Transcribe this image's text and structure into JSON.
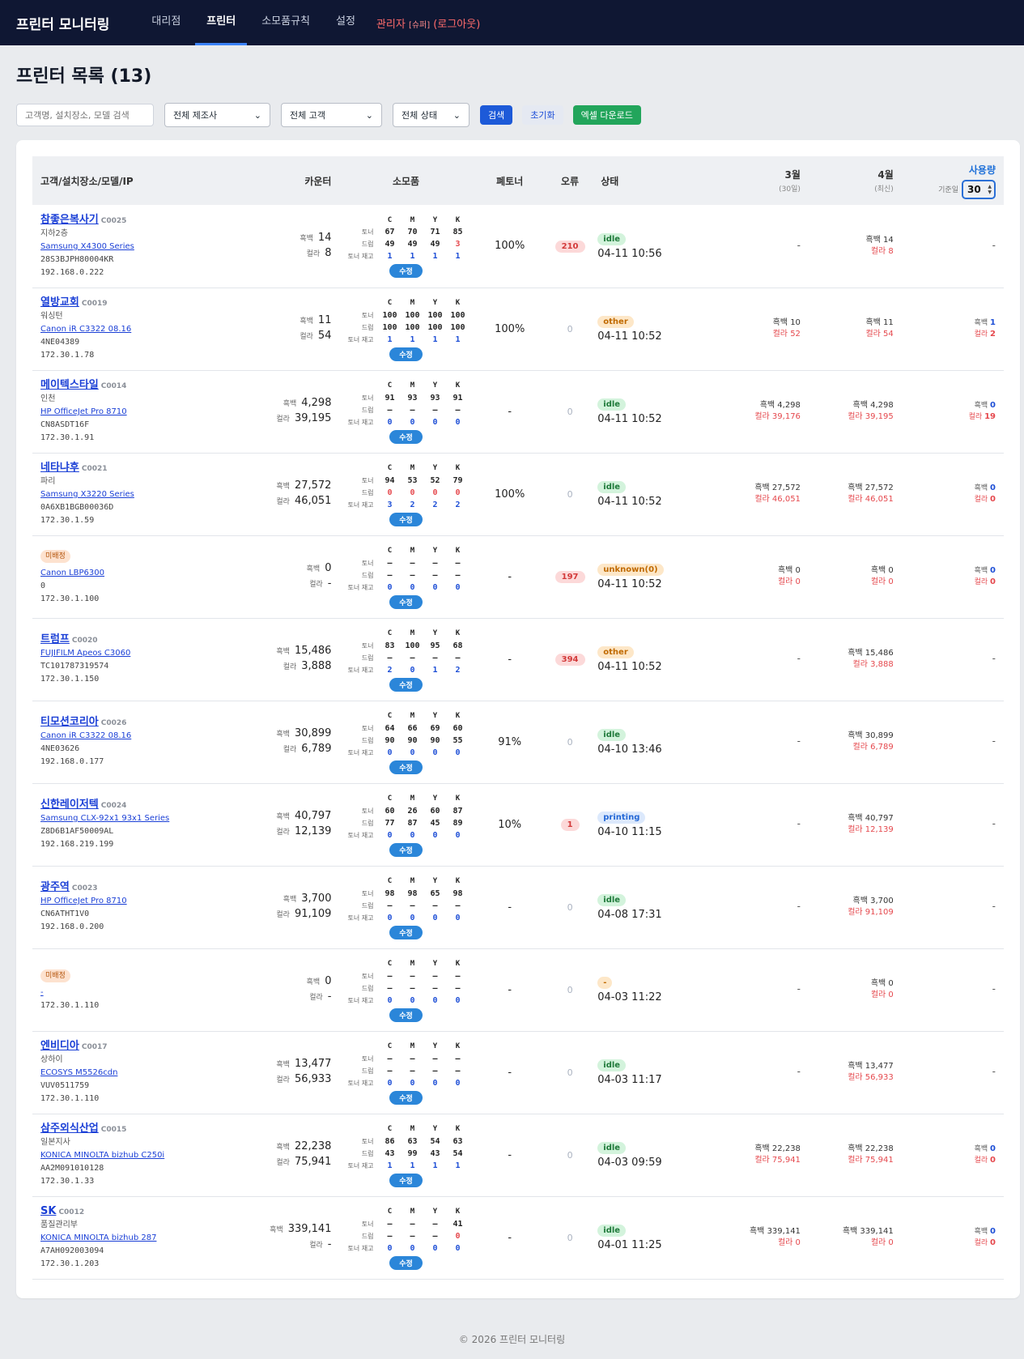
{
  "nav": {
    "brand": "프린터 모니터링",
    "items": [
      "대리점",
      "프린터",
      "소모품규칙",
      "설정"
    ],
    "active": 1,
    "admin_label": "관리자",
    "admin_role": "[슈퍼]",
    "logout": "(로그아웃)"
  },
  "page_title": "프린터 목록 (13)",
  "filters": {
    "search_placeholder": "고객명, 설치장소, 모델 검색",
    "maker": "전체 제조사",
    "customer": "전체 고객",
    "status": "전체 상태",
    "search_btn": "검색",
    "reset_btn": "초기화",
    "excel_btn": "엑셀 다운로드"
  },
  "table_headers": {
    "customer": "고객/설치장소/모델/IP",
    "counter": "카운터",
    "supplies": "소모품",
    "waste": "폐토너",
    "errors": "오류",
    "status": "상태",
    "m1": "3월",
    "m1_sub": "(30일)",
    "m2": "4월",
    "m2_sub": "(최신)",
    "usage": "사용량",
    "basis": "기준일",
    "basis_value": "30"
  },
  "labels": {
    "bw": "흑백",
    "color": "컬라",
    "toner": "토너",
    "drum": "드럼",
    "stock": "토너 재고",
    "edit": "수정",
    "unassigned": "미배정",
    "col_c": "C",
    "col_m": "M",
    "col_y": "Y",
    "col_k": "K"
  },
  "rows": [
    {
      "name": "참좋은복사기",
      "code": "C0025",
      "location": "지하2층",
      "model": "Samsung X4300 Series",
      "serial": "28S3BJPH80004KR",
      "ip": "192.168.0.222",
      "bw": "14",
      "color": "8",
      "toner": [
        "67",
        "70",
        "71",
        "85"
      ],
      "drum": [
        "49",
        "49",
        "49",
        "3"
      ],
      "drum_red": [
        false,
        false,
        false,
        true
      ],
      "stock": [
        "1",
        "1",
        "1",
        "1"
      ],
      "waste": "100%",
      "error": "210",
      "status": "idle",
      "status_class": "idle",
      "time": "04-11 10:56",
      "m1": null,
      "m2": {
        "bw": "14",
        "color": "8"
      },
      "usage": null
    },
    {
      "name": "열방교회",
      "code": "C0019",
      "location": "워싱턴",
      "model": "Canon iR C3322 08.16",
      "serial": "4NE04389",
      "ip": "172.30.1.78",
      "bw": "11",
      "color": "54",
      "toner": [
        "100",
        "100",
        "100",
        "100"
      ],
      "drum": [
        "100",
        "100",
        "100",
        "100"
      ],
      "stock": [
        "1",
        "1",
        "1",
        "1"
      ],
      "waste": "100%",
      "error": "0",
      "status": "other",
      "status_class": "other",
      "time": "04-11 10:52",
      "m1": {
        "bw": "10",
        "color": "52"
      },
      "m2": {
        "bw": "11",
        "color": "54"
      },
      "usage": {
        "bw": "1",
        "color": "2"
      }
    },
    {
      "name": "메이텍스타일",
      "code": "C0014",
      "location": "인천",
      "model": "HP OfficeJet Pro 8710",
      "serial": "CN8ASDT16F",
      "ip": "172.30.1.91",
      "bw": "4,298",
      "color": "39,195",
      "toner": [
        "91",
        "93",
        "93",
        "91"
      ],
      "drum": [
        "–",
        "–",
        "–",
        "–"
      ],
      "stock": [
        "0",
        "0",
        "0",
        "0"
      ],
      "waste": "-",
      "error": "0",
      "status": "idle",
      "status_class": "idle",
      "time": "04-11 10:52",
      "m1": {
        "bw": "4,298",
        "color": "39,176"
      },
      "m2": {
        "bw": "4,298",
        "color": "39,195"
      },
      "usage": {
        "bw": "0",
        "color": "19"
      }
    },
    {
      "name": "네타냐후",
      "code": "C0021",
      "location": "파리",
      "model": "Samsung X3220 Series",
      "serial": "0A6XB1BGB00036D",
      "ip": "172.30.1.59",
      "bw": "27,572",
      "color": "46,051",
      "toner": [
        "94",
        "53",
        "52",
        "79"
      ],
      "drum": [
        "0",
        "0",
        "0",
        "0"
      ],
      "drum_red": [
        true,
        true,
        true,
        true
      ],
      "stock": [
        "3",
        "2",
        "2",
        "2"
      ],
      "waste": "100%",
      "error": "0",
      "status": "idle",
      "status_class": "idle",
      "time": "04-11 10:52",
      "m1": {
        "bw": "27,572",
        "color": "46,051"
      },
      "m2": {
        "bw": "27,572",
        "color": "46,051"
      },
      "usage": {
        "bw": "0",
        "color": "0"
      }
    },
    {
      "unassigned": true,
      "model": "Canon LBP6300",
      "serial": "0",
      "ip": "172.30.1.100",
      "bw": "0",
      "color": "-",
      "toner": [
        "–",
        "–",
        "–",
        "–"
      ],
      "drum": [
        "–",
        "–",
        "–",
        "–"
      ],
      "stock": [
        "0",
        "0",
        "0",
        "0"
      ],
      "waste": "-",
      "error": "197",
      "status": "unknown(0)",
      "status_class": "other",
      "time": "04-11 10:52",
      "m1": {
        "bw": "0",
        "color": "0"
      },
      "m2": {
        "bw": "0",
        "color": "0"
      },
      "usage": {
        "bw": "0",
        "color": "0"
      }
    },
    {
      "name": "트럼프",
      "code": "C0020",
      "model": "FUJIFILM Apeos C3060",
      "serial": "TC101787319574",
      "ip": "172.30.1.150",
      "bw": "15,486",
      "color": "3,888",
      "toner": [
        "83",
        "100",
        "95",
        "68"
      ],
      "drum": [
        "–",
        "–",
        "–",
        "–"
      ],
      "stock": [
        "2",
        "0",
        "1",
        "2"
      ],
      "waste": "-",
      "error": "394",
      "status": "other",
      "status_class": "other",
      "time": "04-11 10:52",
      "m1": null,
      "m2": {
        "bw": "15,486",
        "color": "3,888"
      },
      "usage": null
    },
    {
      "name": "티모션코리아",
      "code": "C0026",
      "model": "Canon iR C3322 08.16",
      "serial": "4NE03626",
      "ip": "192.168.0.177",
      "bw": "30,899",
      "color": "6,789",
      "toner": [
        "64",
        "66",
        "69",
        "60"
      ],
      "drum": [
        "90",
        "90",
        "90",
        "55"
      ],
      "stock": [
        "0",
        "0",
        "0",
        "0"
      ],
      "waste": "91%",
      "error": "0",
      "status": "idle",
      "status_class": "idle",
      "time": "04-10 13:46",
      "m1": null,
      "m2": {
        "bw": "30,899",
        "color": "6,789"
      },
      "usage": null
    },
    {
      "name": "신한레이저텍",
      "code": "C0024",
      "model": "Samsung CLX-92x1 93x1 Series",
      "serial": "Z8D6B1AF50009AL",
      "ip": "192.168.219.199",
      "bw": "40,797",
      "color": "12,139",
      "toner": [
        "60",
        "26",
        "60",
        "87"
      ],
      "drum": [
        "77",
        "87",
        "45",
        "89"
      ],
      "stock": [
        "0",
        "0",
        "0",
        "0"
      ],
      "waste": "10%",
      "error": "1",
      "status": "printing",
      "status_class": "printing",
      "time": "04-10 11:15",
      "m1": null,
      "m2": {
        "bw": "40,797",
        "color": "12,139"
      },
      "usage": null
    },
    {
      "name": "광주역",
      "code": "C0023",
      "model": "HP OfficeJet Pro 8710",
      "serial": "CN6ATHT1V0",
      "ip": "192.168.0.200",
      "bw": "3,700",
      "color": "91,109",
      "toner": [
        "98",
        "98",
        "65",
        "98"
      ],
      "drum": [
        "–",
        "–",
        "–",
        "–"
      ],
      "stock": [
        "0",
        "0",
        "0",
        "0"
      ],
      "waste": "-",
      "error": "0",
      "status": "idle",
      "status_class": "idle",
      "time": "04-08 17:31",
      "m1": null,
      "m2": {
        "bw": "3,700",
        "color": "91,109"
      },
      "usage": null
    },
    {
      "unassigned": true,
      "model": "-",
      "serial": "",
      "ip": "172.30.1.110",
      "bw": "0",
      "color": "-",
      "toner": [
        "–",
        "–",
        "–",
        "–"
      ],
      "drum": [
        "–",
        "–",
        "–",
        "–"
      ],
      "stock": [
        "0",
        "0",
        "0",
        "0"
      ],
      "waste": "-",
      "error": "0",
      "status": "-",
      "status_class": "other",
      "time": "04-03 11:22",
      "m1": null,
      "m2": {
        "bw": "0",
        "color": "0"
      },
      "usage": null
    },
    {
      "name": "엔비디아",
      "code": "C0017",
      "location": "상하이",
      "model": "ECOSYS M5526cdn",
      "serial": "VUV0511759",
      "ip": "172.30.1.110",
      "bw": "13,477",
      "color": "56,933",
      "toner": [
        "–",
        "–",
        "–",
        "–"
      ],
      "drum": [
        "–",
        "–",
        "–",
        "–"
      ],
      "stock": [
        "0",
        "0",
        "0",
        "0"
      ],
      "waste": "-",
      "error": "0",
      "status": "idle",
      "status_class": "idle",
      "time": "04-03 11:17",
      "m1": null,
      "m2": {
        "bw": "13,477",
        "color": "56,933"
      },
      "usage": null
    },
    {
      "name": "삼주외식산업",
      "code": "C0015",
      "location": "일본지사",
      "model": "KONICA MINOLTA bizhub C250i",
      "serial": "AA2M091010128",
      "ip": "172.30.1.33",
      "bw": "22,238",
      "color": "75,941",
      "toner": [
        "86",
        "63",
        "54",
        "63"
      ],
      "drum": [
        "43",
        "99",
        "43",
        "54"
      ],
      "stock": [
        "1",
        "1",
        "1",
        "1"
      ],
      "waste": "-",
      "error": "0",
      "status": "idle",
      "status_class": "idle",
      "time": "04-03 09:59",
      "m1": {
        "bw": "22,238",
        "color": "75,941"
      },
      "m2": {
        "bw": "22,238",
        "color": "75,941"
      },
      "usage": {
        "bw": "0",
        "color": "0"
      }
    },
    {
      "name": "SK",
      "code": "C0012",
      "location": "품질관리부",
      "model": "KONICA MINOLTA bizhub 287",
      "serial": "A7AH092003094",
      "ip": "172.30.1.203",
      "bw": "339,141",
      "color": "-",
      "toner": [
        "–",
        "–",
        "–",
        "41"
      ],
      "drum": [
        "–",
        "–",
        "–",
        "0"
      ],
      "drum_red": [
        false,
        false,
        false,
        true
      ],
      "stock": [
        "0",
        "0",
        "0",
        "0"
      ],
      "waste": "-",
      "error": "0",
      "status": "idle",
      "status_class": "idle",
      "time": "04-01 11:25",
      "m1": {
        "bw": "339,141",
        "color": "0"
      },
      "m2": {
        "bw": "339,141",
        "color": "0"
      },
      "usage": {
        "bw": "0",
        "color": "0"
      }
    }
  ],
  "footer": "© 2026 프린터 모니터링"
}
